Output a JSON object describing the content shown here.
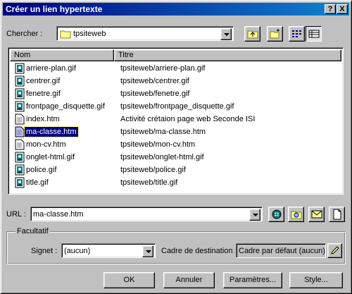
{
  "window": {
    "title": "Créer un lien hypertexte",
    "help_label": "?",
    "close_label": "X"
  },
  "search": {
    "label": "Chercher :",
    "folder": "tpsiteweb"
  },
  "list": {
    "columns": [
      "Nom",
      "Titre"
    ],
    "rows": [
      {
        "name": "arriere-plan.gif",
        "title": "tpsiteweb/arriere-plan.gif",
        "type": "gif"
      },
      {
        "name": "centrer.gif",
        "title": "tpsiteweb/centrer.gif",
        "type": "gif"
      },
      {
        "name": "fenetre.gif",
        "title": "tpsiteweb/fenetre.gif",
        "type": "gif"
      },
      {
        "name": "frontpage_disquette.gif",
        "title": "tpsiteweb/frontpage_disquette.gif",
        "type": "gif"
      },
      {
        "name": "index.htm",
        "title": "Activité crétaion page web Seconde ISI",
        "type": "htm"
      },
      {
        "name": "ma-classe.htm",
        "title": "tpsiteweb/ma-classe.htm",
        "type": "htm",
        "selected": true
      },
      {
        "name": "mon-cv.htm",
        "title": "tpsiteweb/mon-cv.htm",
        "type": "htm"
      },
      {
        "name": "onglet-html.gif",
        "title": "tpsiteweb/onglet-html.gif",
        "type": "gif"
      },
      {
        "name": "police.gif",
        "title": "tpsiteweb/police.gif",
        "type": "gif"
      },
      {
        "name": "title.gif",
        "title": "tpsiteweb/title.gif",
        "type": "gif"
      }
    ]
  },
  "url": {
    "label": "URL :",
    "value": "ma-classe.htm"
  },
  "optional": {
    "legend": "Facultatif",
    "signet_label": "Signet :",
    "signet_value": "(aucun)",
    "target_label": "Cadre de destination :",
    "target_value": "Cadre par défaut (aucun)"
  },
  "buttons": {
    "ok": "OK",
    "cancel": "Annuler",
    "params": "Paramètres...",
    "style": "Style..."
  },
  "colors": {
    "title_start": "#000080",
    "title_end": "#1084d0",
    "selection": "#000080"
  }
}
